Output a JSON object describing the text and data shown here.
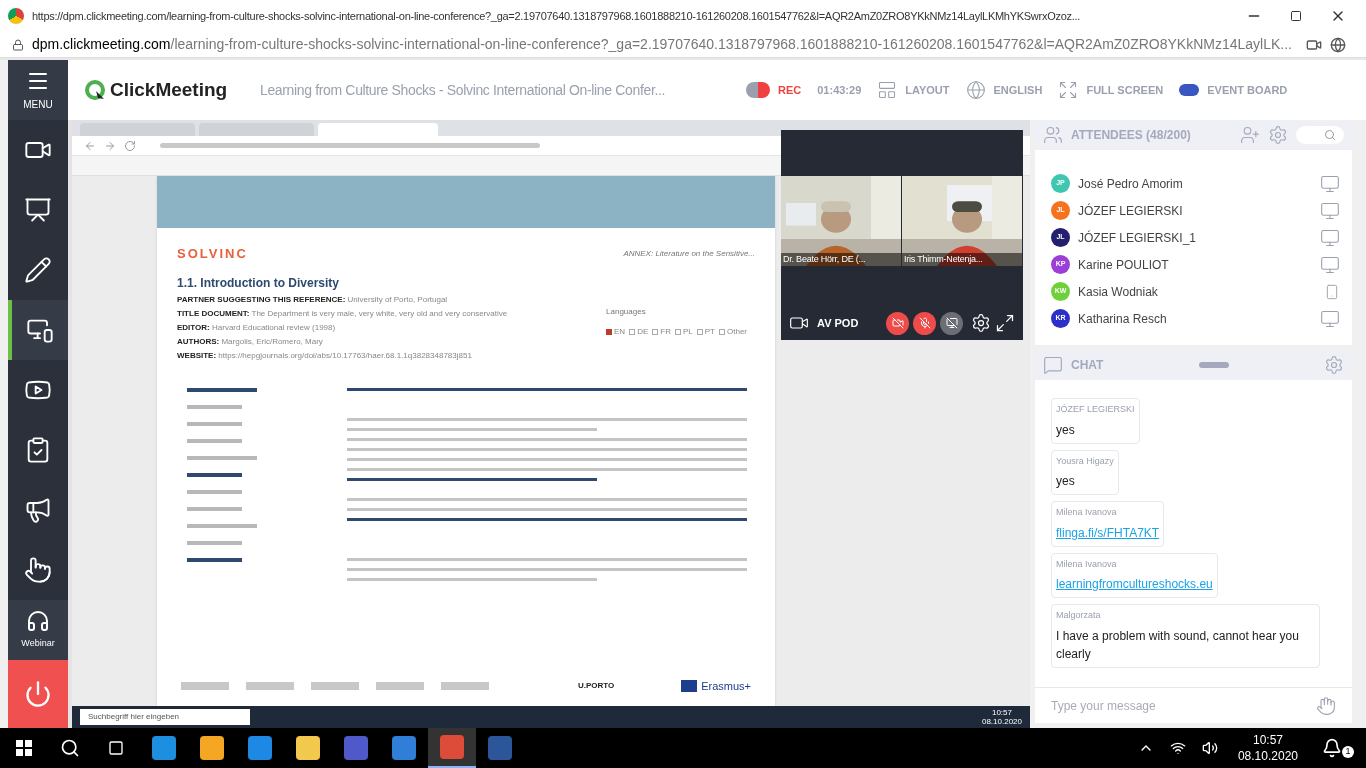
{
  "browser": {
    "title": "https://dpm.clickmeeting.com/learning-from-culture-shocks-solvinc-international-on-line-conference?_ga=2.19707640.1318797968.1601888210-161260208.1601547762&l=AQR2AmZ0ZRO8YKkNMz14LaylLKMhYKSwrxOzoz...",
    "address_host": "dpm.clickmeeting.com",
    "address_path": "/learning-from-culture-shocks-solvinc-international-on-line-conference?_ga=2.19707640.1318797968.1601888210-161260208.1601547762&l=AQR2AmZ0ZRO8YKkNMz14LaylLK..."
  },
  "header": {
    "logo": "ClickMeeting",
    "title": "Learning from Culture Shocks - Solvinc International On-line Confer...",
    "rec": {
      "label": "REC",
      "time": "01:43:29",
      "on": true
    },
    "nav": [
      {
        "kind": "layout",
        "label": "LAYOUT"
      },
      {
        "kind": "globe",
        "label": "ENGLISH"
      },
      {
        "kind": "fullscreen",
        "label": "FULL SCREEN"
      },
      {
        "kind": "board",
        "label": "EVENT BOARD"
      }
    ]
  },
  "sidebar": {
    "menu_label": "MENU",
    "items": [
      {
        "kind": "camera",
        "selected": false
      },
      {
        "kind": "presentation",
        "selected": false
      },
      {
        "kind": "pencil",
        "selected": false
      },
      {
        "kind": "screen",
        "selected": true
      },
      {
        "kind": "youtube",
        "selected": false
      },
      {
        "kind": "clipboard",
        "selected": false
      },
      {
        "kind": "megaphone",
        "selected": false
      },
      {
        "kind": "touch",
        "selected": false
      }
    ],
    "webinar_label": "Webinar"
  },
  "shared_screen": {
    "document": {
      "brand": "SOLVINC",
      "annex": "ANNEX: Literature on the Sensitive...",
      "heading": "1.1. Introduction to Diversity",
      "fields": [
        {
          "label": "PARTNER SUGGESTING THIS REFERENCE:",
          "value": "University of Porto, Portugal"
        },
        {
          "label": "TITLE DOCUMENT:",
          "value": "The Department is very male, very white, very old and very conservative"
        },
        {
          "label": "EDITOR:",
          "value": "Harvard Educational review (1998)"
        },
        {
          "label": "AUTHORS:",
          "value": "Margolis, Eric/Romero, Mary"
        },
        {
          "label": "WEBSITE:",
          "value": "https://hepgjournals.org/doi/abs/10.17763/haer.68.1.1q3828348783j851"
        }
      ],
      "languages_label": "Languages",
      "languages": [
        {
          "code": "EN",
          "checked": true
        },
        {
          "code": "DE",
          "checked": false
        },
        {
          "code": "FR",
          "checked": false
        },
        {
          "code": "PL",
          "checked": false
        },
        {
          "code": "PT",
          "checked": false
        },
        {
          "code": "Other",
          "checked": false
        }
      ],
      "footer_logos": [
        "U.PORTO",
        "Erasmus+"
      ]
    },
    "taskbar": {
      "search": "Suchbegriff hier eingeben",
      "time": "10:57",
      "date": "08.10.2020"
    }
  },
  "av_pod": {
    "title": "AV POD",
    "videos": [
      {
        "name": "Dr. Beate Hörr, DE (..."
      },
      {
        "name": "Iris Thimm-Netenja..."
      }
    ],
    "controls": [
      {
        "kind": "camera-off",
        "on": true
      },
      {
        "kind": "mic-off",
        "on": true
      },
      {
        "kind": "screen-off",
        "on": false
      }
    ]
  },
  "attendees": {
    "title": "ATTENDEES (48/200)",
    "items": [
      {
        "initials": "JP",
        "name": "José Pedro Amorim",
        "color": "#3ec6b0",
        "kind": "desktop"
      },
      {
        "initials": "JL",
        "name": "JÓZEF LEGIERSKI",
        "color": "#f5731f",
        "kind": "desktop"
      },
      {
        "initials": "JL",
        "name": "JÓZEF LEGIERSKI_1",
        "color": "#231f6e",
        "kind": "desktop"
      },
      {
        "initials": "KP",
        "name": "Karine POULIOT",
        "color": "#9b3fd6",
        "kind": "desktop"
      },
      {
        "initials": "KW",
        "name": "Kasia Wodniak",
        "color": "#6fd03a",
        "kind": "app"
      },
      {
        "initials": "KR",
        "name": "Katharina Resch",
        "color": "#2c2fc8",
        "kind": "desktop"
      }
    ]
  },
  "chat": {
    "title": "CHAT",
    "messages": [
      {
        "author": "JÓZEF LEGIERSKI",
        "text": "yes",
        "kind": "text"
      },
      {
        "author": "Yousra Higazy",
        "text": "yes",
        "kind": "text"
      },
      {
        "author": "Milena Ivanova",
        "text": "flinga.fi/s/FHTA7KT",
        "kind": "link"
      },
      {
        "author": "Milena Ivanova",
        "text": "learningfromcultureshocks.eu",
        "kind": "link"
      },
      {
        "author": "Malgorzata",
        "text": "I have a problem with sound, cannot hear you clearly",
        "kind": "text"
      }
    ],
    "placeholder": "Type your message"
  },
  "taskbar": {
    "time": "10:57",
    "date": "08.10.2020",
    "notifications": "1"
  }
}
